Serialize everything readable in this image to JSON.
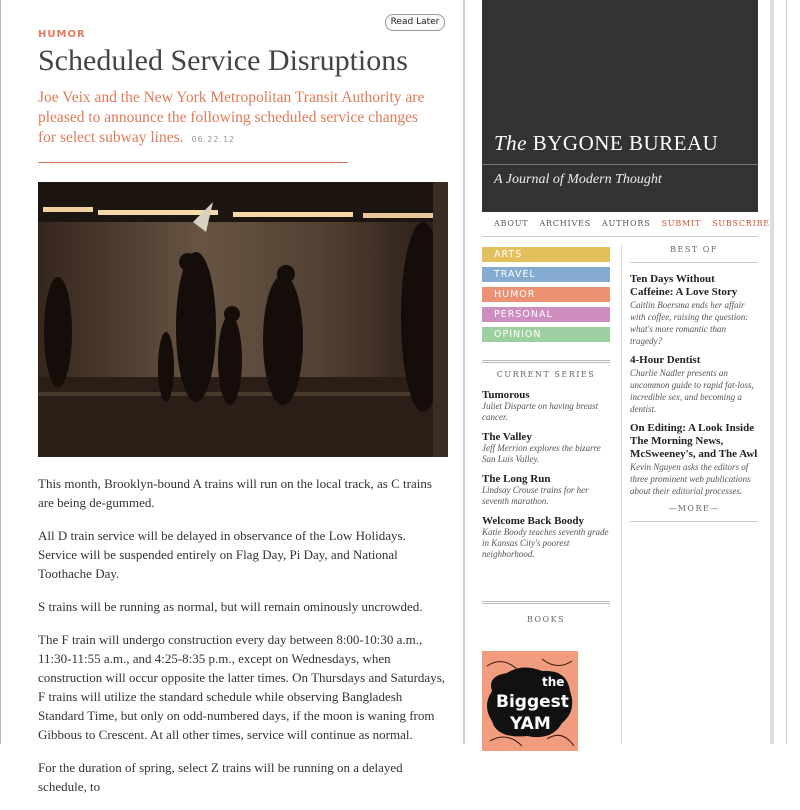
{
  "article": {
    "category": "HUMOR",
    "read_later": "Read Later",
    "title": "Scheduled Service Disruptions",
    "dek": "Joe Veix and the New York Metropolitan Transit Authority are pleased to announce the following scheduled service changes for select subway lines.",
    "date": "06.22.12",
    "paragraphs": [
      "This month, Brooklyn-bound A trains will run on the local track, as C trains are being de-gummed.",
      "All D train service will be delayed in observance of the Low Holidays. Service will be suspended entirely on Flag Day, Pi Day, and National Toothache Day.",
      "S trains will be running as normal, but will remain ominously uncrowded.",
      "The F train will undergo construction every day between 8:00-10:30 a.m., 11:30-11:55 a.m., and 4:25-8:35 p.m., except on Wednesdays, when construction will occur opposite the latter times. On Thursdays and Saturdays, F trains will utilize the standard schedule while observing Bangladesh Standard Time, but only on odd-numbered days, if the moon is waning from Gibbous to Crescent. At all other times, service will continue as normal.",
      "For the duration of spring, select Z trains will be running on a delayed schedule, to"
    ]
  },
  "masthead": {
    "the": "The",
    "name": "BYGONE BUREAU",
    "tagline": "A Journal of Modern Thought"
  },
  "nav": [
    "ABOUT",
    "ARCHIVES",
    "AUTHORS",
    "SUBMIT",
    "SUBSCRIBE"
  ],
  "categories": [
    {
      "label": "ARTS",
      "color": "#e3c05c"
    },
    {
      "label": "TRAVEL",
      "color": "#86abd1"
    },
    {
      "label": "HUMOR",
      "color": "#ec9272"
    },
    {
      "label": "PERSONAL",
      "color": "#cf8ec0"
    },
    {
      "label": "OPINION",
      "color": "#9dd0a0"
    }
  ],
  "current_series": {
    "heading": "CURRENT SERIES",
    "items": [
      {
        "title": "Tumorous",
        "desc": "Juliet Disparte on having breast cancer."
      },
      {
        "title": "The Valley",
        "desc": "Jeff Merrion explores the bizarre San Luis Valley."
      },
      {
        "title": "The Long Run",
        "desc": "Lindsay Crouse trains for her seventh marathon."
      },
      {
        "title": "Welcome Back Boody",
        "desc": "Katie Boody teaches seventh grade in Kansas City's poorest neighborhood."
      }
    ]
  },
  "books": {
    "heading": "BOOKS",
    "cover_text": [
      "the",
      "Biggest",
      "YAM"
    ]
  },
  "best_of": {
    "heading": "BEST OF",
    "items": [
      {
        "title": "Ten Days Without Caffeine: A Love Story",
        "desc": "Caitlin Boersma ends her affair with coffee, raising the question: what's more romantic than tragedy?"
      },
      {
        "title": "4-Hour Dentist",
        "desc": "Charlie Nadler presents an uncommon guide to rapid fat-loss, incredible sex, and becoming a dentist."
      },
      {
        "title": "On Editing: A Look Inside The Morning News, McSweeney's, and The Awl",
        "desc": "Kevin Nguyen asks the editors of three prominent web publications about their editorial processes."
      }
    ],
    "more": "—MORE—"
  }
}
